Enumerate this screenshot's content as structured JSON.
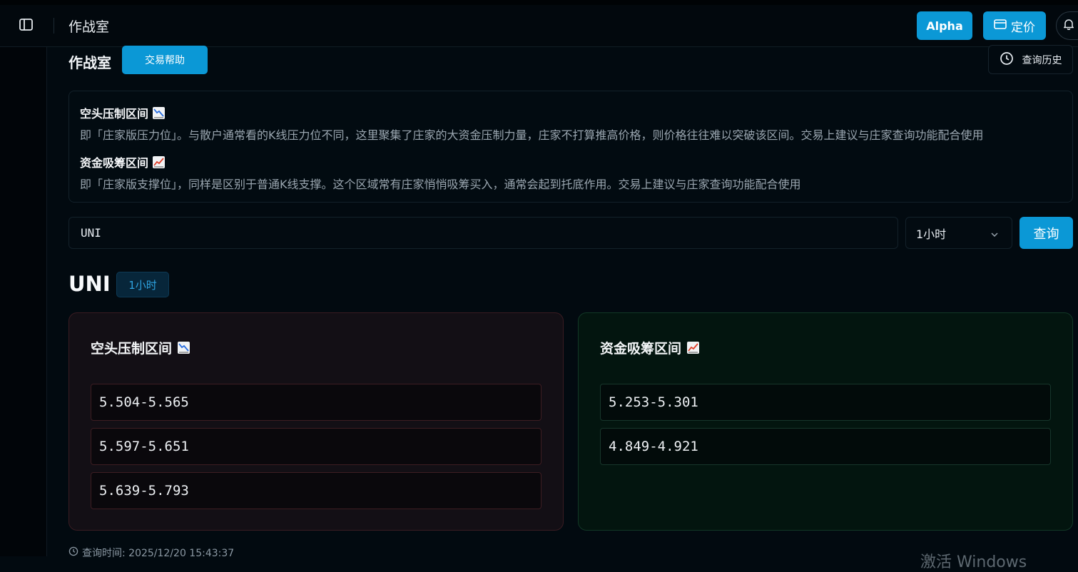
{
  "topbar": {
    "app_title": "作战室",
    "alpha_label": "Alpha",
    "pricing_label": "定价"
  },
  "page": {
    "title": "作战室",
    "help_label": "交易帮助",
    "history_label": "查询历史"
  },
  "info": {
    "resist_title": "空头压制区间",
    "resist_desc": "即「庄家版压力位」。与散户通常看的K线压力位不同，这里聚集了庄家的大资金压制力量，庄家不打算推高价格，则价格往往难以突破该区间。交易上建议与庄家查询功能配合使用",
    "support_title": "资金吸筹区间",
    "support_desc": "即「庄家版支撑位」，同样是区别于普通K线支撑。这个区域常有庄家悄悄吸筹买入，通常会起到托底作用。交易上建议与庄家查询功能配合使用"
  },
  "search": {
    "value": "UNI",
    "timeframe": "1小时",
    "query_label": "查询"
  },
  "result": {
    "symbol": "UNI",
    "timeframe": "1小时",
    "resist": {
      "title": "空头压制区间",
      "ranges": [
        "5.504-5.565",
        "5.597-5.651",
        "5.639-5.793"
      ]
    },
    "support": {
      "title": "资金吸筹区间",
      "ranges": [
        "5.253-5.301",
        "4.849-4.921"
      ]
    },
    "query_time": "查询时间: 2025/12/20 15:43:37"
  },
  "watermark": "激活 Windows",
  "icons": {
    "sidebar_toggle": "sidebar-toggle-icon",
    "pricing": "credit-card-icon",
    "bell": "bell-icon",
    "history": "clock-icon",
    "chart_down": "chart-decreasing-icon",
    "chart_up": "chart-increasing-icon",
    "chevron": "chevron-down-icon"
  },
  "colors": {
    "accent": "#0b98d6",
    "background": "#020a10",
    "resist_card": "#130f15",
    "support_card": "#03150f"
  }
}
